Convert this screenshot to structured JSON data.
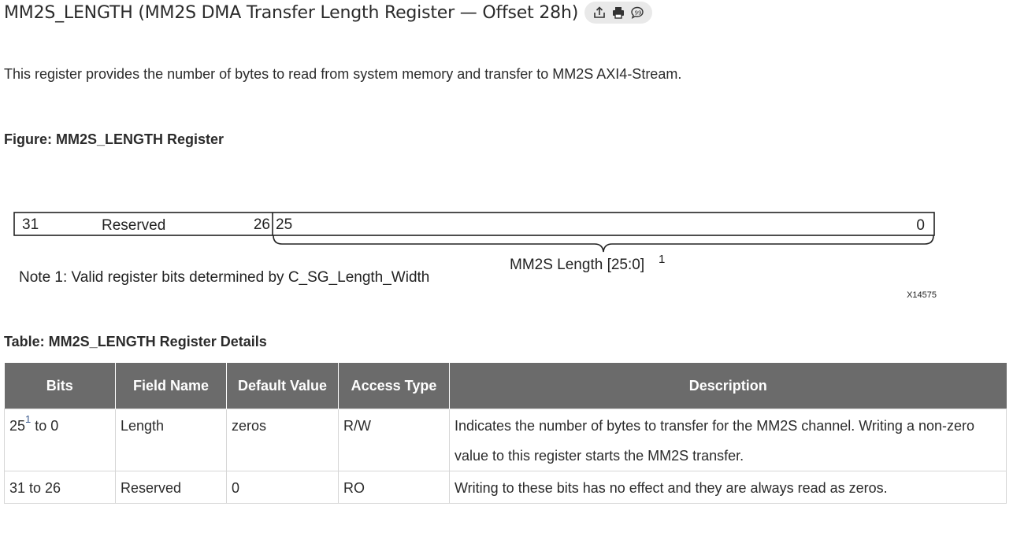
{
  "heading": {
    "title": "MM2S_LENGTH (MM2S DMA Transfer Length Register — Offset 28h)",
    "actions": [
      {
        "icon": "share-icon"
      },
      {
        "icon": "print-icon"
      },
      {
        "icon": "feedback-icon"
      }
    ]
  },
  "intro_text": "This register provides the number of bytes to read from system memory and transfer to MM2S AXI4-Stream.",
  "figure": {
    "caption": "Figure: MM2S_LENGTH Register",
    "reserved": {
      "msb": "31",
      "label": "Reserved",
      "lsb": "26"
    },
    "length": {
      "msb": "25",
      "lsb": "0"
    },
    "brace_label": "MM2S Length [25:0]",
    "brace_note_ref": "1",
    "note": "Note 1: Valid register bits determined by C_SG_Length_Width",
    "figure_id": "X14575"
  },
  "table": {
    "caption": "Table: MM2S_LENGTH Register Details",
    "headers": {
      "bits": "Bits",
      "field_name": "Field Name",
      "default_value": "Default Value",
      "access_type": "Access Type",
      "description": "Description"
    },
    "rows": [
      {
        "bits_start": "25",
        "bits_note": "1",
        "bits_end": " to 0",
        "field_name": "Length",
        "default_value": "zeros",
        "access_type": "R/W",
        "description": "Indicates the number of bytes to transfer for the MM2S channel. Writing a non-zero value to this register starts the MM2S transfer."
      },
      {
        "bits": "31 to 26",
        "field_name": "Reserved",
        "default_value": "0",
        "access_type": "RO",
        "description": "Writing to these bits has no effect and they are always read as zeros."
      }
    ]
  }
}
